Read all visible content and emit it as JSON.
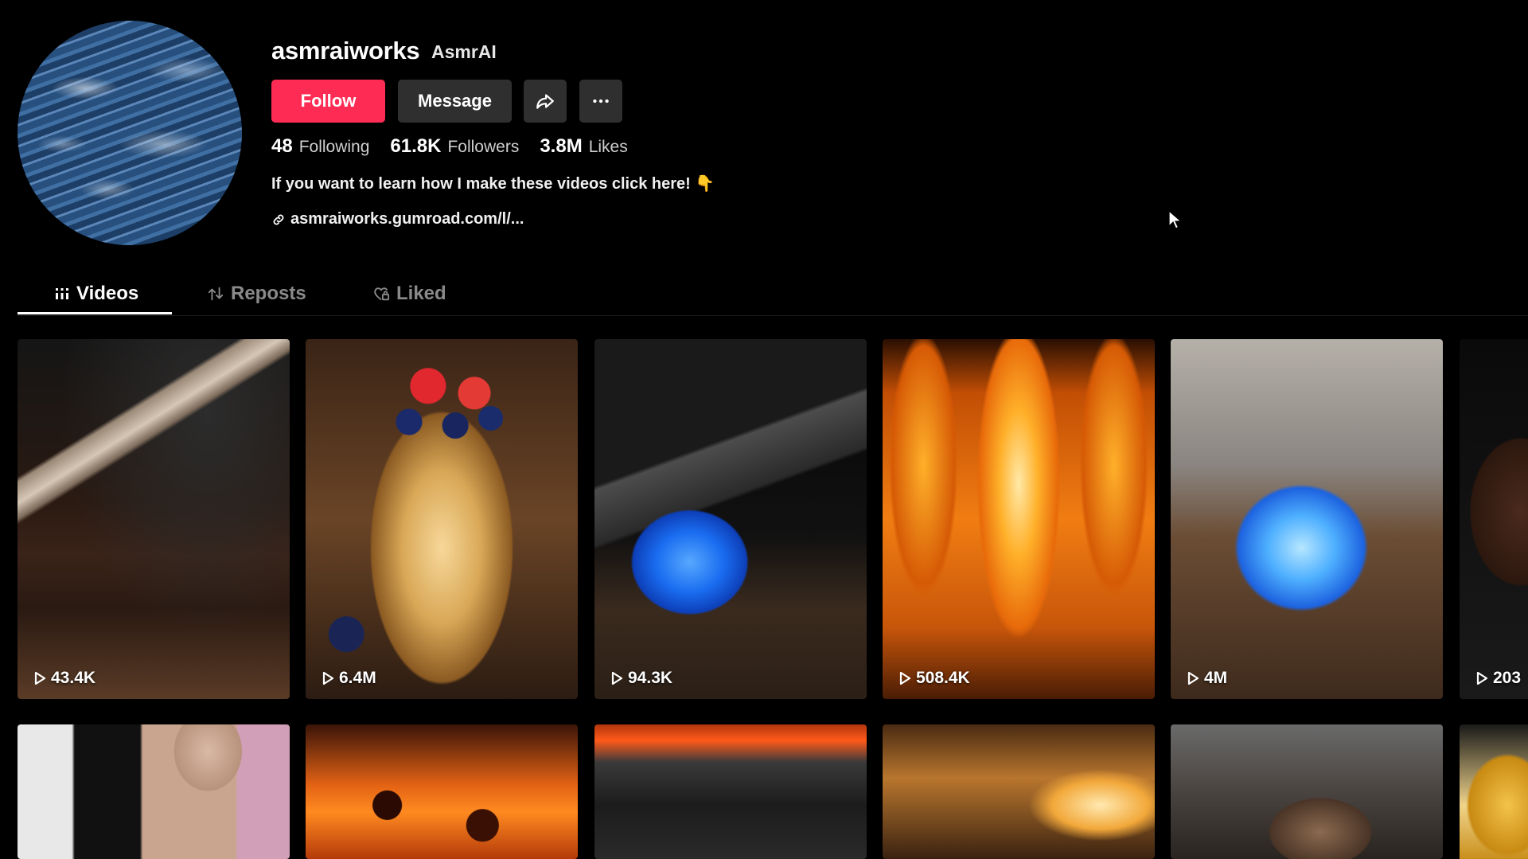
{
  "profile": {
    "username": "asmraiworks",
    "nickname": "AsmrAI",
    "bio": "If you want to learn how I make these videos click here! 👇",
    "link": "asmraiworks.gumroad.com/l/..."
  },
  "actions": {
    "follow_label": "Follow",
    "message_label": "Message",
    "share_icon": "share-icon",
    "more_icon": "more-icon"
  },
  "stats": {
    "following_count": "48",
    "following_label": "Following",
    "followers_count": "61.8K",
    "followers_label": "Followers",
    "likes_count": "3.8M",
    "likes_label": "Likes"
  },
  "tabs": [
    {
      "label": "Videos",
      "icon": "grid-icon",
      "active": true
    },
    {
      "label": "Reposts",
      "icon": "repost-icon",
      "active": false
    },
    {
      "label": "Liked",
      "icon": "heart-lock-icon",
      "active": false
    }
  ],
  "videos": [
    {
      "views": "43.4K"
    },
    {
      "views": "6.4M"
    },
    {
      "views": "94.3K"
    },
    {
      "views": "508.4K"
    },
    {
      "views": "4M"
    },
    {
      "views": "203"
    }
  ],
  "colors": {
    "accent": "#fe2c55",
    "background": "#000000",
    "button_secondary": "#2f2f2f"
  }
}
